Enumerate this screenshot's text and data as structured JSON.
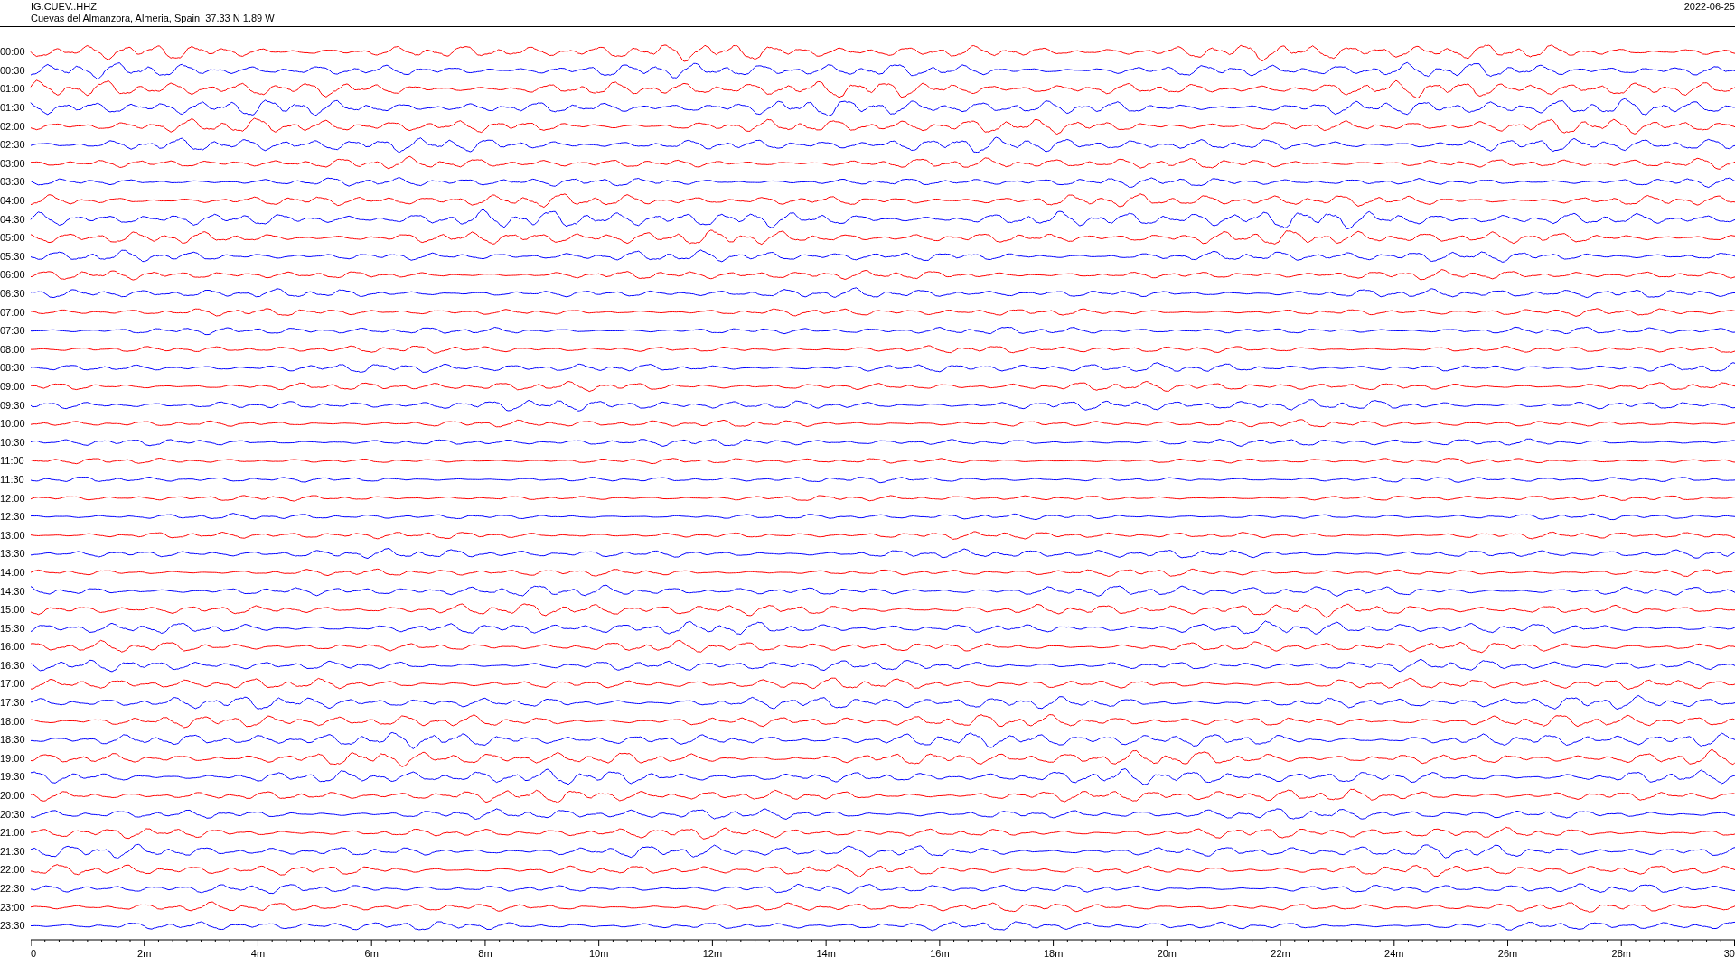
{
  "header": {
    "station": "IG.CUEV..HHZ",
    "location": "Cuevas del Almanzora, Almeria, Spain  37.33 N 1.89 W",
    "date": "2022-06-25"
  },
  "rows": [
    {
      "label": "00:00",
      "color": "#ff0000"
    },
    {
      "label": "00:30",
      "color": "#0000ff"
    },
    {
      "label": "01:00",
      "color": "#ff0000"
    },
    {
      "label": "01:30",
      "color": "#0000ff"
    },
    {
      "label": "02:00",
      "color": "#ff0000"
    },
    {
      "label": "02:30",
      "color": "#0000ff"
    },
    {
      "label": "03:00",
      "color": "#ff0000"
    },
    {
      "label": "03:30",
      "color": "#0000ff"
    },
    {
      "label": "04:00",
      "color": "#ff0000"
    },
    {
      "label": "04:30",
      "color": "#0000ff"
    },
    {
      "label": "05:00",
      "color": "#ff0000"
    },
    {
      "label": "05:30",
      "color": "#0000ff"
    },
    {
      "label": "06:00",
      "color": "#ff0000"
    },
    {
      "label": "06:30",
      "color": "#0000ff"
    },
    {
      "label": "07:00",
      "color": "#ff0000"
    },
    {
      "label": "07:30",
      "color": "#0000ff"
    },
    {
      "label": "08:00",
      "color": "#ff0000"
    },
    {
      "label": "08:30",
      "color": "#0000ff"
    },
    {
      "label": "09:00",
      "color": "#ff0000"
    },
    {
      "label": "09:30",
      "color": "#0000ff"
    },
    {
      "label": "10:00",
      "color": "#ff0000"
    },
    {
      "label": "10:30",
      "color": "#0000ff"
    },
    {
      "label": "11:00",
      "color": "#ff0000"
    },
    {
      "label": "11:30",
      "color": "#0000ff"
    },
    {
      "label": "12:00",
      "color": "#ff0000"
    },
    {
      "label": "12:30",
      "color": "#0000ff"
    },
    {
      "label": "13:00",
      "color": "#ff0000"
    },
    {
      "label": "13:30",
      "color": "#0000ff"
    },
    {
      "label": "14:00",
      "color": "#ff0000"
    },
    {
      "label": "14:30",
      "color": "#0000ff"
    },
    {
      "label": "15:00",
      "color": "#ff0000"
    },
    {
      "label": "15:30",
      "color": "#0000ff"
    },
    {
      "label": "16:00",
      "color": "#ff0000"
    },
    {
      "label": "16:30",
      "color": "#0000ff"
    },
    {
      "label": "17:00",
      "color": "#ff0000"
    },
    {
      "label": "17:30",
      "color": "#0000ff"
    },
    {
      "label": "18:00",
      "color": "#ff0000"
    },
    {
      "label": "18:30",
      "color": "#0000ff"
    },
    {
      "label": "19:00",
      "color": "#ff0000"
    },
    {
      "label": "19:30",
      "color": "#0000ff"
    },
    {
      "label": "20:00",
      "color": "#ff0000"
    },
    {
      "label": "20:30",
      "color": "#0000ff"
    },
    {
      "label": "21:00",
      "color": "#ff0000"
    },
    {
      "label": "21:30",
      "color": "#0000ff"
    },
    {
      "label": "22:00",
      "color": "#ff0000"
    },
    {
      "label": "22:30",
      "color": "#0000ff"
    },
    {
      "label": "23:00",
      "color": "#ff0000"
    },
    {
      "label": "23:30",
      "color": "#0000ff"
    }
  ],
  "x_axis": {
    "tick_labels": [
      "0",
      "2m",
      "4m",
      "6m",
      "8m",
      "10m",
      "12m",
      "14m",
      "16m",
      "18m",
      "20m",
      "22m",
      "24m",
      "26m",
      "28m",
      "30"
    ]
  }
}
